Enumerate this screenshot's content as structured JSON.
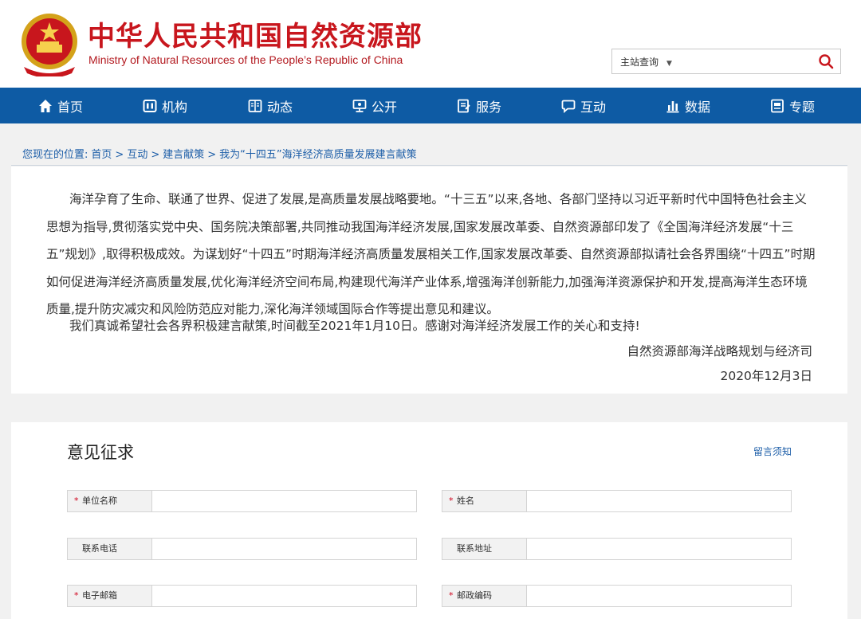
{
  "site": {
    "title_cn": "中华人民共和国自然资源部",
    "title_en": "Ministry of Natural Resources of the People’s Republic of China"
  },
  "search": {
    "scope_label": "主站查询",
    "placeholder": ""
  },
  "nav": [
    {
      "label": "首页",
      "icon": "home-icon"
    },
    {
      "label": "机构",
      "icon": "org-icon"
    },
    {
      "label": "动态",
      "icon": "news-icon"
    },
    {
      "label": "公开",
      "icon": "public-icon"
    },
    {
      "label": "服务",
      "icon": "service-icon"
    },
    {
      "label": "互动",
      "icon": "interact-icon"
    },
    {
      "label": "数据",
      "icon": "data-icon"
    },
    {
      "label": "专题",
      "icon": "topic-icon"
    }
  ],
  "breadcrumb": {
    "prefix": "您现在的位置:",
    "items": [
      "首页",
      "互动",
      "建言献策",
      "我为“十四五”海洋经济高质量发展建言献策"
    ],
    "separator": ">"
  },
  "article": {
    "para1": "海洋孕育了生命、联通了世界、促进了发展,是高质量发展战略要地。“十三五”以来,各地、各部门坚持以习近平新时代中国特色社会主义思想为指导,贯彻落实党中央、国务院决策部署,共同推动我国海洋经济发展,国家发展改革委、自然资源部印发了《全国海洋经济发展“十三五”规划》,取得积极成效。为谋划好“十四五”时期海洋经济高质量发展相关工作,国家发展改革委、自然资源部拟请社会各界围绕“十四五”时期如何促进海洋经济高质量发展,优化海洋经济空间布局,构建现代海洋产业体系,增强海洋创新能力,加强海洋资源保护和开发,提高海洋生态环境质量,提升防灾减灾和风险防范应对能力,深化海洋领域国际合作等提出意见和建议。",
    "para2": "我们真诚希望社会各界积极建言献策,时间截至2021年1月10日。感谢对海洋经济发展工作的关心和支持!",
    "signature": "自然资源部海洋战略规划与经济司",
    "date": "2020年12月3日"
  },
  "form": {
    "title": "意见征求",
    "notice_link": "留言须知",
    "fields": [
      {
        "label": "单位名称",
        "required": "*",
        "value": ""
      },
      {
        "label": "姓名",
        "required": "*",
        "value": ""
      },
      {
        "label": "联系电话",
        "required": "",
        "value": ""
      },
      {
        "label": "联系地址",
        "required": "",
        "value": ""
      },
      {
        "label": "电子邮箱",
        "required": "*",
        "value": ""
      },
      {
        "label": "邮政编码",
        "required": "*",
        "value": ""
      }
    ]
  },
  "colors": {
    "brand_red": "#c8161d",
    "nav_blue": "#0e5ba4",
    "link_blue": "#1d5ea8",
    "required_red": "#d0021b"
  }
}
